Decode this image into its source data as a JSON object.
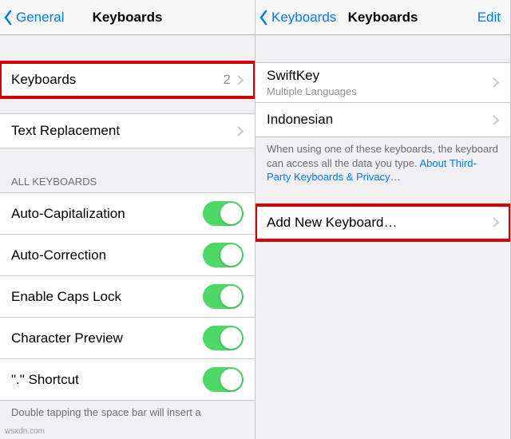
{
  "left": {
    "nav": {
      "back": "General",
      "title": "Keyboards"
    },
    "row_keyboards": {
      "label": "Keyboards",
      "detail": "2"
    },
    "row_text_replacement": {
      "label": "Text Replacement"
    },
    "section_all_keyboards": "ALL KEYBOARDS",
    "toggles": {
      "auto_cap": "Auto-Capitalization",
      "auto_corr": "Auto-Correction",
      "caps_lock": "Enable Caps Lock",
      "char_preview": "Character Preview",
      "period_shortcut": "\".\" Shortcut"
    },
    "footer_period": "Double tapping the space bar will insert a"
  },
  "right": {
    "nav": {
      "back": "Keyboards",
      "title": "Keyboards",
      "edit": "Edit"
    },
    "kb_list": {
      "swiftkey": {
        "name": "SwiftKey",
        "sub": "Multiple Languages"
      },
      "indonesian": {
        "name": "Indonesian"
      }
    },
    "third_party_note": "When using one of these keyboards, the keyboard can access all the data you type. ",
    "third_party_link": "About Third-Party Keyboards & Privacy…",
    "add_new": "Add New Keyboard…"
  },
  "watermark": "wsxdn.com"
}
